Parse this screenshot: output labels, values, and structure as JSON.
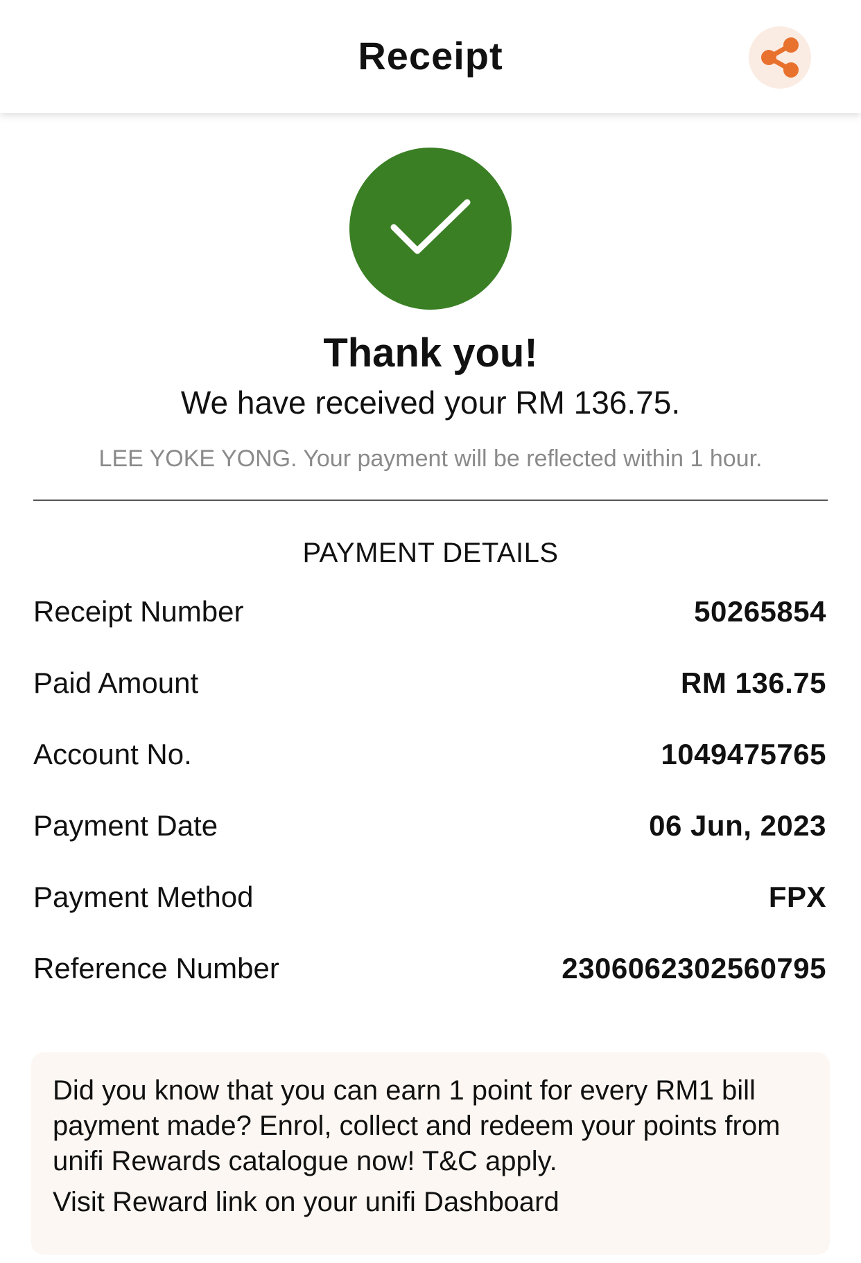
{
  "header": {
    "title": "Receipt",
    "share_icon": "share-icon",
    "accent_color": "#e8712e"
  },
  "status": {
    "icon": "checkmark-icon",
    "color": "#3a7f24",
    "headline": "Thank you!",
    "message": "We have received your RM 136.75.",
    "note": "LEE YOKE YONG. Your payment will be reflected within 1 hour."
  },
  "details": {
    "title": "PAYMENT DETAILS",
    "rows": [
      {
        "label": "Receipt Number",
        "value": "50265854"
      },
      {
        "label": "Paid Amount",
        "value": "RM 136.75"
      },
      {
        "label": "Account No.",
        "value": "1049475765"
      },
      {
        "label": "Payment Date",
        "value": "06 Jun, 2023"
      },
      {
        "label": "Payment Method",
        "value": "FPX"
      },
      {
        "label": "Reference Number",
        "value": "2306062302560795"
      }
    ]
  },
  "promo": {
    "text": "Did you know that you can earn 1 point for every RM1 bill payment made? Enrol, collect and redeem your points from unifi Rewards catalogue now! T&C apply.",
    "link_text": "Visit Reward link on your unifi Dashboard"
  }
}
